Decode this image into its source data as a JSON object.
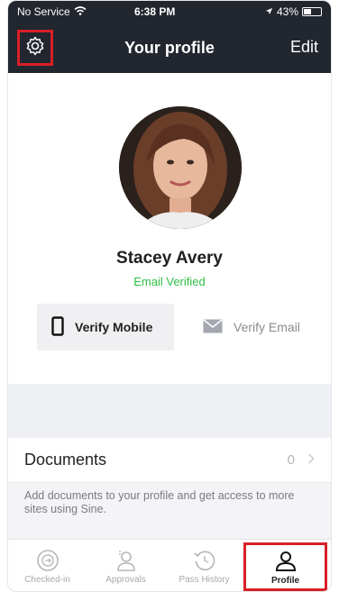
{
  "status_bar": {
    "carrier": "No Service",
    "time": "6:38 PM",
    "battery": "43%",
    "battery_level": 0.43
  },
  "nav": {
    "title": "Your profile",
    "edit_label": "Edit",
    "settings_icon": "gear-icon"
  },
  "profile": {
    "name": "Stacey Avery",
    "email_status": "Email Verified",
    "verify_mobile_label": "Verify Mobile",
    "verify_email_label": "Verify Email"
  },
  "documents": {
    "label": "Documents",
    "count": "0",
    "hint": "Add documents to your profile and get access to more sites using Sine."
  },
  "tabs": [
    {
      "label": "Checked-in",
      "icon": "checked-in-icon"
    },
    {
      "label": "Approvals",
      "icon": "approvals-icon"
    },
    {
      "label": "Pass History",
      "icon": "history-icon"
    },
    {
      "label": "Profile",
      "icon": "profile-icon"
    }
  ],
  "colors": {
    "nav_bg": "#22262f",
    "highlight": "#d81f26",
    "verified_green": "#2fbf45"
  }
}
